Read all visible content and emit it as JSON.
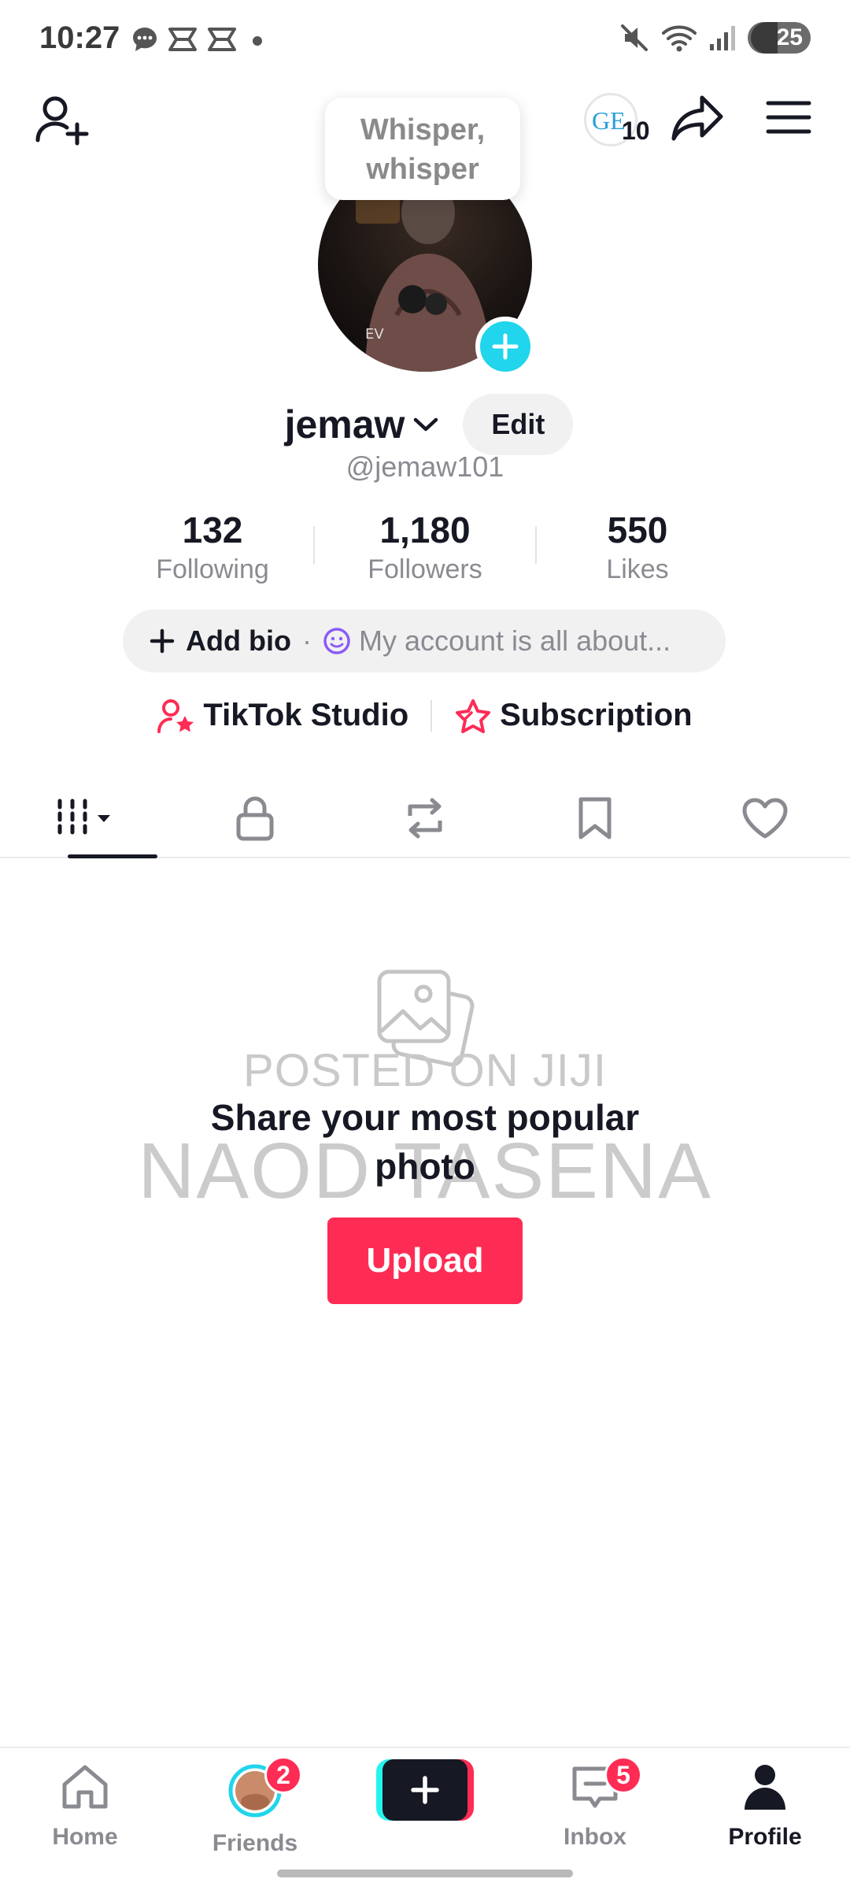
{
  "status_bar": {
    "time": "10:27",
    "left_icons": [
      "chat-bubble-icon",
      "capcut-icon",
      "capcut-icon",
      "dot-icon"
    ],
    "right_icons": [
      "mute-icon",
      "wifi-icon",
      "signal-icon"
    ],
    "battery": "25"
  },
  "header": {
    "notification_count": "10",
    "icons": [
      "add-friend-icon",
      "share-icon",
      "menu-icon"
    ]
  },
  "whisper_bubble": {
    "line1": "Whisper,",
    "line2": "whisper"
  },
  "profile": {
    "username": "jemaw",
    "handle": "@jemaw101",
    "edit_label": "Edit"
  },
  "stats": [
    {
      "value": "132",
      "label": "Following"
    },
    {
      "value": "1,180",
      "label": "Followers"
    },
    {
      "value": "550",
      "label": "Likes"
    }
  ],
  "bio": {
    "add_label": "Add bio",
    "separator": "·",
    "placeholder": "My account is all about..."
  },
  "tools": {
    "studio_label": "TikTok Studio",
    "subscription_label": "Subscription"
  },
  "tabs": [
    "videos-grid-tab",
    "private-tab",
    "reposts-tab",
    "favorites-tab",
    "liked-tab"
  ],
  "empty_state": {
    "title_line1": "Share your most popular",
    "title_line2": "photo",
    "upload_label": "Upload",
    "watermark_line1": "POSTED ON JIJI",
    "watermark_line2": "NAOD TASENA"
  },
  "bottom_nav": {
    "home": "Home",
    "friends": "Friends",
    "friends_badge": "2",
    "inbox": "Inbox",
    "inbox_badge": "5",
    "profile": "Profile"
  },
  "colors": {
    "accent": "#fe2c55",
    "cyan": "#20d5ec",
    "text": "#161823",
    "muted": "#8a8b91"
  }
}
